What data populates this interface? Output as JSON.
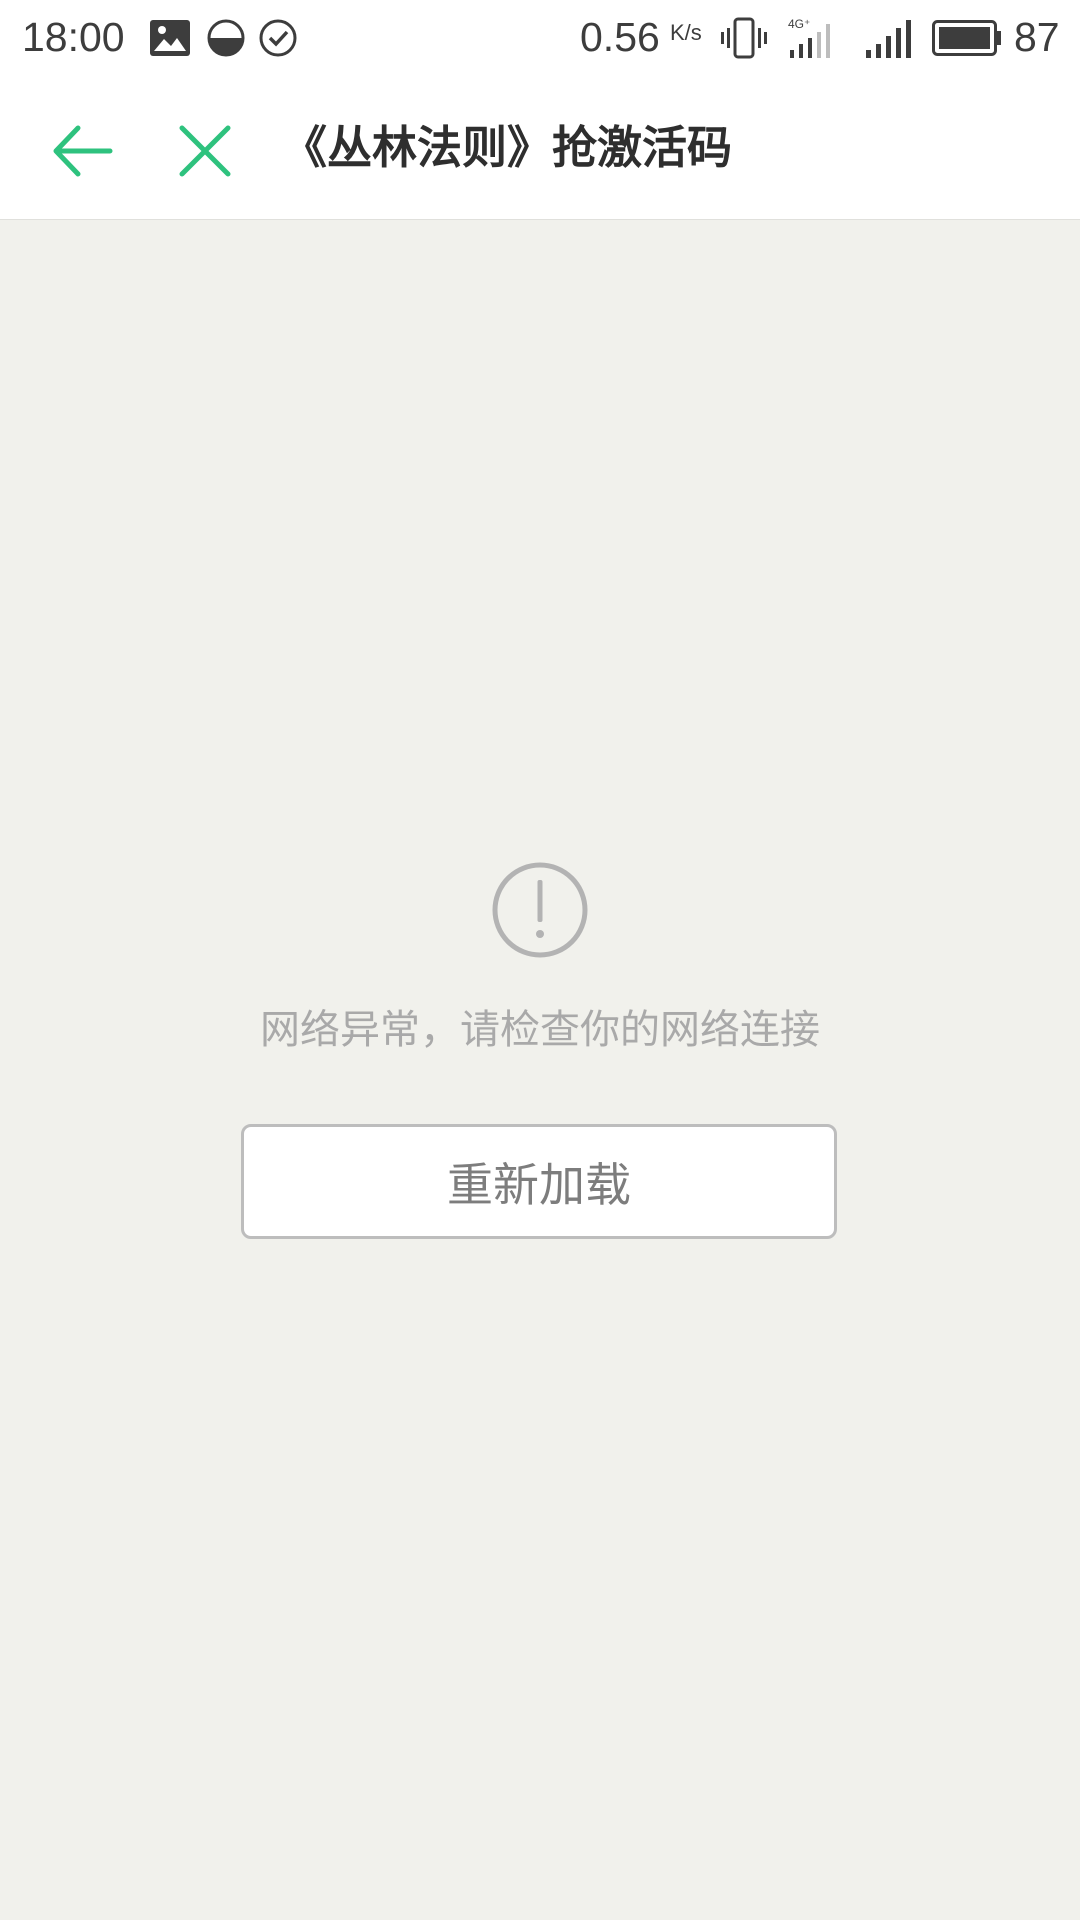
{
  "status_bar": {
    "time": "18:00",
    "icons": [
      "image-icon",
      "half-moon-icon",
      "check-circle-icon"
    ],
    "network_speed": "0.56",
    "network_speed_unit": "K/s",
    "network_type": "4G",
    "battery_level": "87"
  },
  "header": {
    "title": "《丛林法则》抢激活码",
    "accent_color": "#2ec27e"
  },
  "error": {
    "message": "网络异常，请检查你的网络连接",
    "reload_label": "重新加载"
  }
}
